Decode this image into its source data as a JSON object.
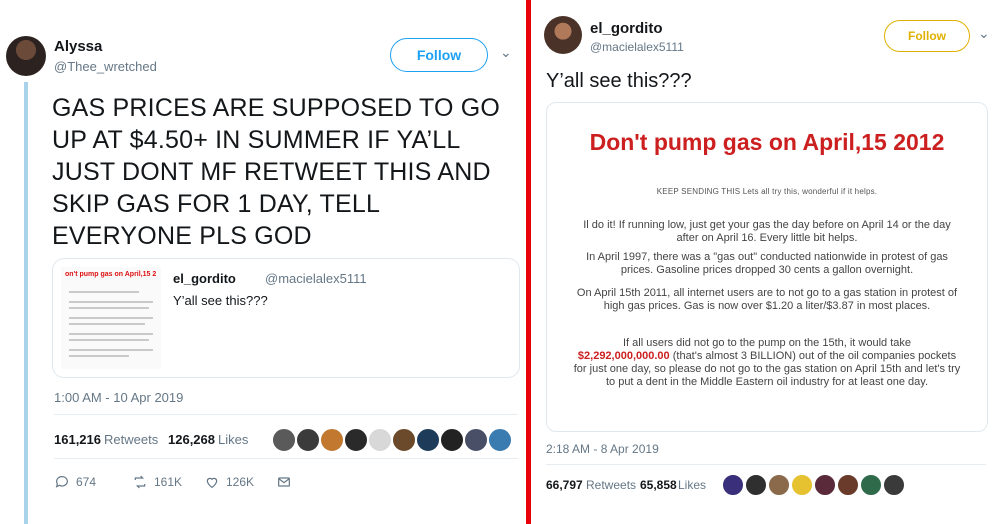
{
  "left_tweet": {
    "display_name": "Alyssa",
    "handle": "@Thee_wretched",
    "follow_label": "Follow",
    "text": "GAS PRICES ARE SUPPOSED TO GO UP AT $4.50+ IN SUMMER IF YA’LL JUST DONT MF RETWEET THIS AND SKIP GAS FOR 1 DAY, TELL EVERYONE PLS GOD",
    "quote": {
      "thumb_title": "on't pump gas on April,15 2",
      "name": "el_gordito",
      "handle": "@macielalex5111",
      "text": "Y’all see this???"
    },
    "timestamp": "1:00 AM - 10 Apr 2019",
    "retweets_count": "161,216",
    "retweets_label": "Retweets",
    "likes_count": "126,268",
    "likes_label": "Likes",
    "actions": {
      "replies": "674",
      "retweets": "161K",
      "likes": "126K"
    },
    "liker_colors": [
      "#5a5a5a",
      "#3b3b3b",
      "#c2792f",
      "#2a2a2a",
      "#d8d8d8",
      "#6a4a2a",
      "#1f3b5a",
      "#222222",
      "#4a4f68",
      "#3a7bb0"
    ]
  },
  "right_tweet": {
    "display_name": "el_gordito",
    "handle": "@macielalex5111",
    "follow_label": "Follow",
    "text": "Y’all see this???",
    "image": {
      "title": "Don't pump gas on April,15 2012",
      "subtitle": "KEEP SENDING THIS  Lets all try this, wonderful if it helps.",
      "p1": "Il do it! If running low, just get your gas the day before on April 14 or the day after on April 16. Every little bit helps.",
      "p2": "In April 1997, there was a \"gas out\" conducted nationwide in protest of gas prices. Gasoline prices dropped 30 cents a gallon overnight.",
      "p3": "On April 15th 2011, all internet users are to not go to a gas station in protest of high gas prices. Gas is now over $1.20 a liter/$3.87 in most places.",
      "p4_start": "If all users did not go to the pump on the 15th, it would take",
      "p4_money": "$2,292,000,000.00",
      "p4_end": " (that's almost 3 BILLION) out of the oil companies pockets for just one day, so please do not go to the gas station on April 15th and let's try to put a dent in the Middle Eastern oil industry for at least one day."
    },
    "timestamp": "2:18 AM - 8 Apr 2019",
    "retweets_count": "66,797",
    "retweets_label": "Retweets",
    "likes_count": "65,858",
    "likes_label": "Likes",
    "liker_colors": [
      "#3a2f7a",
      "#2f2f2f",
      "#8a6a4a",
      "#e6c230",
      "#5a2a3a",
      "#6a3a2a",
      "#2f6a4a",
      "#3a3a3a"
    ]
  },
  "colors": {
    "divider": "#e8000b",
    "link_blue": "#1da1f2",
    "muted": "#657786",
    "headline_red": "#cc1f1f"
  }
}
